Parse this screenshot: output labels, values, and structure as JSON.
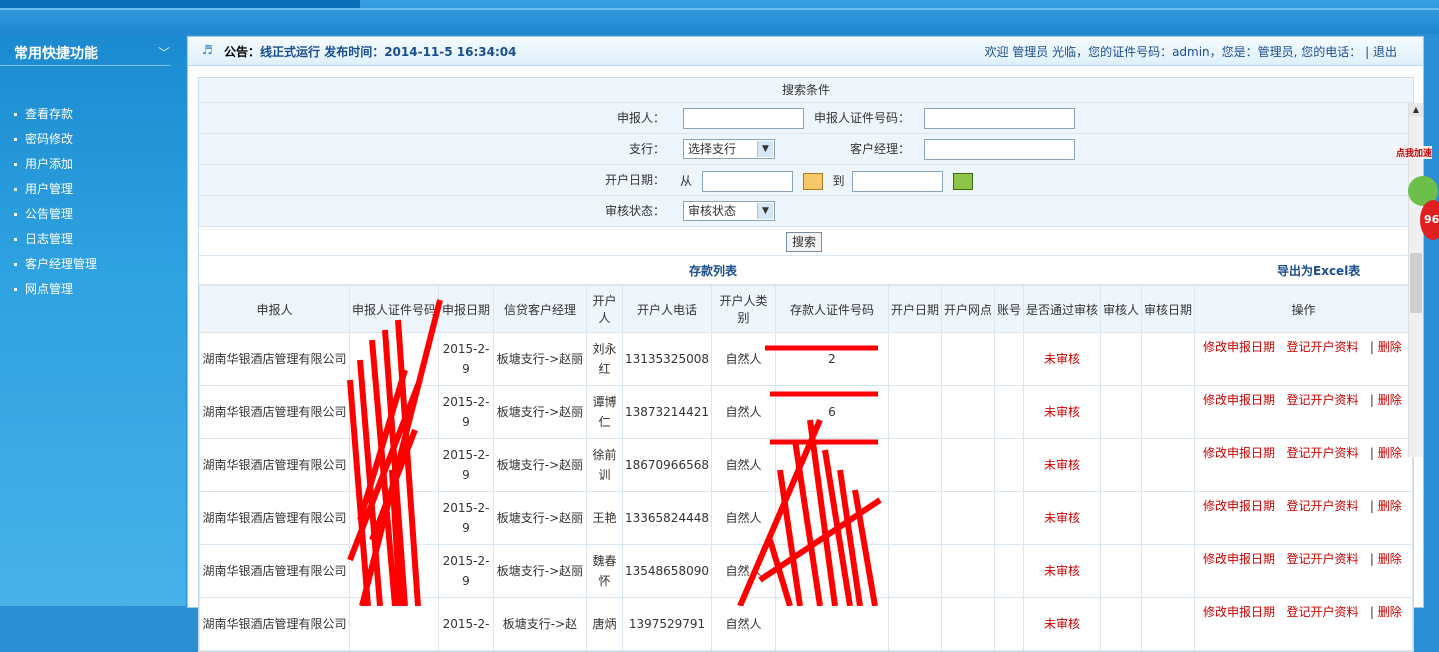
{
  "sidebar": {
    "title": "常用快捷功能",
    "items": [
      "查看存款",
      "密码修改",
      "用户添加",
      "用户管理",
      "公告管理",
      "日志管理",
      "客户经理管理",
      "网点管理"
    ]
  },
  "notice": {
    "prefix": "公告：",
    "text": "线正式运行 发布时间：2014-11-5 16:34:04",
    "welcome": "欢迎 管理员 光临，您的证件号码：admin，您是：管理员, 您的电话：",
    "logout": "退出"
  },
  "search": {
    "caption": "搜索条件",
    "reporter_label": "申报人：",
    "reporter_id_label": "申报人证件号码：",
    "branch_label": "支行：",
    "branch_value": "选择支行",
    "manager_label": "客户经理：",
    "date_label": "开户日期：",
    "date_from": "从",
    "date_to": "到",
    "status_label": "审核状态：",
    "status_value": "审核状态",
    "search_button": "搜索"
  },
  "list": {
    "title": "存款列表",
    "export": "导出为Excel表",
    "headers": [
      "申报人",
      "申报人证件号码",
      "申报日期",
      "信贷客户经理",
      "开户人",
      "开户人电话",
      "开户人类别",
      "存款人证件号码",
      "开户日期",
      "开户网点",
      "账号",
      "是否通过审核",
      "审核人",
      "审核日期",
      "操作"
    ],
    "rows": [
      {
        "reporter": "湖南华银酒店管理有限公司",
        "date": "2015-2-9",
        "manager": "板塘支行->赵丽",
        "holder": "刘永红",
        "phone": "13135325008",
        "type": "自然人",
        "depositor_id": "2",
        "status": "未审核"
      },
      {
        "reporter": "湖南华银酒店管理有限公司",
        "date": "2015-2-9",
        "manager": "板塘支行->赵丽",
        "holder": "谭博仁",
        "phone": "13873214421",
        "type": "自然人",
        "depositor_id": "6",
        "status": "未审核"
      },
      {
        "reporter": "湖南华银酒店管理有限公司",
        "date": "2015-2-9",
        "manager": "板塘支行->赵丽",
        "holder": "徐前训",
        "phone": "18670966568",
        "type": "自然人",
        "depositor_id": "",
        "status": "未审核"
      },
      {
        "reporter": "湖南华银酒店管理有限公司",
        "date": "2015-2-9",
        "manager": "板塘支行->赵丽",
        "holder": "王艳",
        "phone": "13365824448",
        "type": "自然人",
        "depositor_id": "",
        "status": "未审核"
      },
      {
        "reporter": "湖南华银酒店管理有限公司",
        "date": "2015-2-9",
        "manager": "板塘支行->赵丽",
        "holder": "魏春怀",
        "phone": "13548658090",
        "type": "自然人",
        "depositor_id": "",
        "status": "未审核"
      },
      {
        "reporter": "湖南华银酒店管理有限公司",
        "date": "2015-2-",
        "manager": "板塘支行->赵",
        "holder": "唐炳",
        "phone": "1397529791",
        "type": "自然人",
        "depositor_id": "",
        "status": "未审核"
      }
    ],
    "actions": {
      "edit_date": "修改申报日期",
      "register": "登记开户资料",
      "delete": "删除"
    }
  },
  "badge": {
    "label": "点我加速",
    "value": "96"
  }
}
